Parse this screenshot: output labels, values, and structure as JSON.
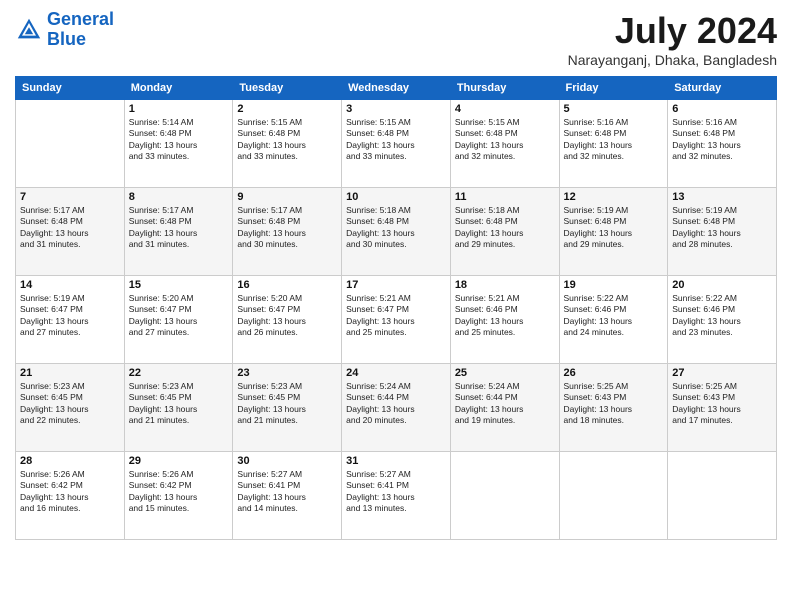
{
  "header": {
    "logo_line1": "General",
    "logo_line2": "Blue",
    "month": "July 2024",
    "location": "Narayanganj, Dhaka, Bangladesh"
  },
  "weekdays": [
    "Sunday",
    "Monday",
    "Tuesday",
    "Wednesday",
    "Thursday",
    "Friday",
    "Saturday"
  ],
  "weeks": [
    [
      {
        "day": "",
        "info": ""
      },
      {
        "day": "1",
        "info": "Sunrise: 5:14 AM\nSunset: 6:48 PM\nDaylight: 13 hours\nand 33 minutes."
      },
      {
        "day": "2",
        "info": "Sunrise: 5:15 AM\nSunset: 6:48 PM\nDaylight: 13 hours\nand 33 minutes."
      },
      {
        "day": "3",
        "info": "Sunrise: 5:15 AM\nSunset: 6:48 PM\nDaylight: 13 hours\nand 33 minutes."
      },
      {
        "day": "4",
        "info": "Sunrise: 5:15 AM\nSunset: 6:48 PM\nDaylight: 13 hours\nand 32 minutes."
      },
      {
        "day": "5",
        "info": "Sunrise: 5:16 AM\nSunset: 6:48 PM\nDaylight: 13 hours\nand 32 minutes."
      },
      {
        "day": "6",
        "info": "Sunrise: 5:16 AM\nSunset: 6:48 PM\nDaylight: 13 hours\nand 32 minutes."
      }
    ],
    [
      {
        "day": "7",
        "info": "Sunrise: 5:17 AM\nSunset: 6:48 PM\nDaylight: 13 hours\nand 31 minutes."
      },
      {
        "day": "8",
        "info": "Sunrise: 5:17 AM\nSunset: 6:48 PM\nDaylight: 13 hours\nand 31 minutes."
      },
      {
        "day": "9",
        "info": "Sunrise: 5:17 AM\nSunset: 6:48 PM\nDaylight: 13 hours\nand 30 minutes."
      },
      {
        "day": "10",
        "info": "Sunrise: 5:18 AM\nSunset: 6:48 PM\nDaylight: 13 hours\nand 30 minutes."
      },
      {
        "day": "11",
        "info": "Sunrise: 5:18 AM\nSunset: 6:48 PM\nDaylight: 13 hours\nand 29 minutes."
      },
      {
        "day": "12",
        "info": "Sunrise: 5:19 AM\nSunset: 6:48 PM\nDaylight: 13 hours\nand 29 minutes."
      },
      {
        "day": "13",
        "info": "Sunrise: 5:19 AM\nSunset: 6:48 PM\nDaylight: 13 hours\nand 28 minutes."
      }
    ],
    [
      {
        "day": "14",
        "info": "Sunrise: 5:19 AM\nSunset: 6:47 PM\nDaylight: 13 hours\nand 27 minutes."
      },
      {
        "day": "15",
        "info": "Sunrise: 5:20 AM\nSunset: 6:47 PM\nDaylight: 13 hours\nand 27 minutes."
      },
      {
        "day": "16",
        "info": "Sunrise: 5:20 AM\nSunset: 6:47 PM\nDaylight: 13 hours\nand 26 minutes."
      },
      {
        "day": "17",
        "info": "Sunrise: 5:21 AM\nSunset: 6:47 PM\nDaylight: 13 hours\nand 25 minutes."
      },
      {
        "day": "18",
        "info": "Sunrise: 5:21 AM\nSunset: 6:46 PM\nDaylight: 13 hours\nand 25 minutes."
      },
      {
        "day": "19",
        "info": "Sunrise: 5:22 AM\nSunset: 6:46 PM\nDaylight: 13 hours\nand 24 minutes."
      },
      {
        "day": "20",
        "info": "Sunrise: 5:22 AM\nSunset: 6:46 PM\nDaylight: 13 hours\nand 23 minutes."
      }
    ],
    [
      {
        "day": "21",
        "info": "Sunrise: 5:23 AM\nSunset: 6:45 PM\nDaylight: 13 hours\nand 22 minutes."
      },
      {
        "day": "22",
        "info": "Sunrise: 5:23 AM\nSunset: 6:45 PM\nDaylight: 13 hours\nand 21 minutes."
      },
      {
        "day": "23",
        "info": "Sunrise: 5:23 AM\nSunset: 6:45 PM\nDaylight: 13 hours\nand 21 minutes."
      },
      {
        "day": "24",
        "info": "Sunrise: 5:24 AM\nSunset: 6:44 PM\nDaylight: 13 hours\nand 20 minutes."
      },
      {
        "day": "25",
        "info": "Sunrise: 5:24 AM\nSunset: 6:44 PM\nDaylight: 13 hours\nand 19 minutes."
      },
      {
        "day": "26",
        "info": "Sunrise: 5:25 AM\nSunset: 6:43 PM\nDaylight: 13 hours\nand 18 minutes."
      },
      {
        "day": "27",
        "info": "Sunrise: 5:25 AM\nSunset: 6:43 PM\nDaylight: 13 hours\nand 17 minutes."
      }
    ],
    [
      {
        "day": "28",
        "info": "Sunrise: 5:26 AM\nSunset: 6:42 PM\nDaylight: 13 hours\nand 16 minutes."
      },
      {
        "day": "29",
        "info": "Sunrise: 5:26 AM\nSunset: 6:42 PM\nDaylight: 13 hours\nand 15 minutes."
      },
      {
        "day": "30",
        "info": "Sunrise: 5:27 AM\nSunset: 6:41 PM\nDaylight: 13 hours\nand 14 minutes."
      },
      {
        "day": "31",
        "info": "Sunrise: 5:27 AM\nSunset: 6:41 PM\nDaylight: 13 hours\nand 13 minutes."
      },
      {
        "day": "",
        "info": ""
      },
      {
        "day": "",
        "info": ""
      },
      {
        "day": "",
        "info": ""
      }
    ]
  ]
}
